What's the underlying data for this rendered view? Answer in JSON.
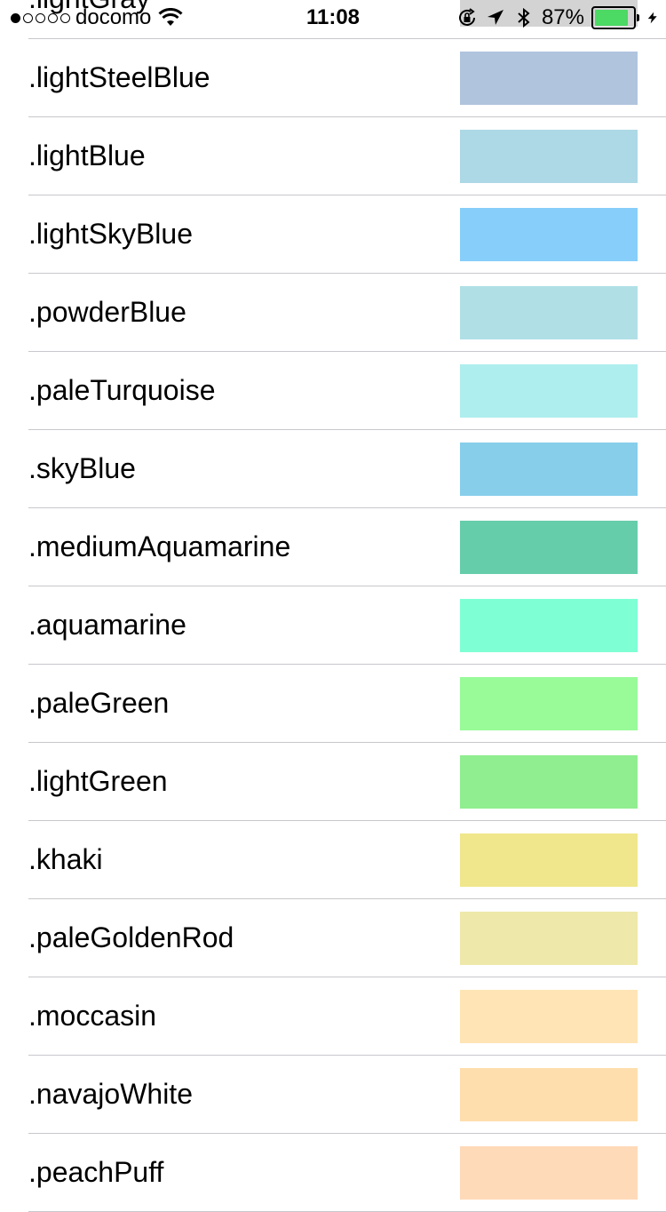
{
  "status_bar": {
    "carrier": "docomo",
    "time": "11:08",
    "battery_percent": "87%",
    "battery_level": 0.87,
    "icons": [
      "signal-dots-icon",
      "wifi-icon",
      "orientation-lock-icon",
      "location-arrow-icon",
      "bluetooth-icon",
      "battery-icon",
      "charging-bolt-icon"
    ]
  },
  "peek_row": {
    "label": ".lightGray",
    "color": "#d3d3d3"
  },
  "rows": [
    {
      "label": ".lightSteelBlue",
      "color": "#b0c4de"
    },
    {
      "label": ".lightBlue",
      "color": "#add8e6"
    },
    {
      "label": ".lightSkyBlue",
      "color": "#87cefa"
    },
    {
      "label": ".powderBlue",
      "color": "#b0e0e6"
    },
    {
      "label": ".paleTurquoise",
      "color": "#afeeee"
    },
    {
      "label": ".skyBlue",
      "color": "#87ceeb"
    },
    {
      "label": ".mediumAquamarine",
      "color": "#66cdaa"
    },
    {
      "label": ".aquamarine",
      "color": "#7fffd4"
    },
    {
      "label": ".paleGreen",
      "color": "#98fb98"
    },
    {
      "label": ".lightGreen",
      "color": "#90ee90"
    },
    {
      "label": ".khaki",
      "color": "#f0e68c"
    },
    {
      "label": ".paleGoldenRod",
      "color": "#eee8aa"
    },
    {
      "label": ".moccasin",
      "color": "#ffe4b5"
    },
    {
      "label": ".navajoWhite",
      "color": "#ffdead"
    },
    {
      "label": ".peachPuff",
      "color": "#ffdab9"
    }
  ]
}
